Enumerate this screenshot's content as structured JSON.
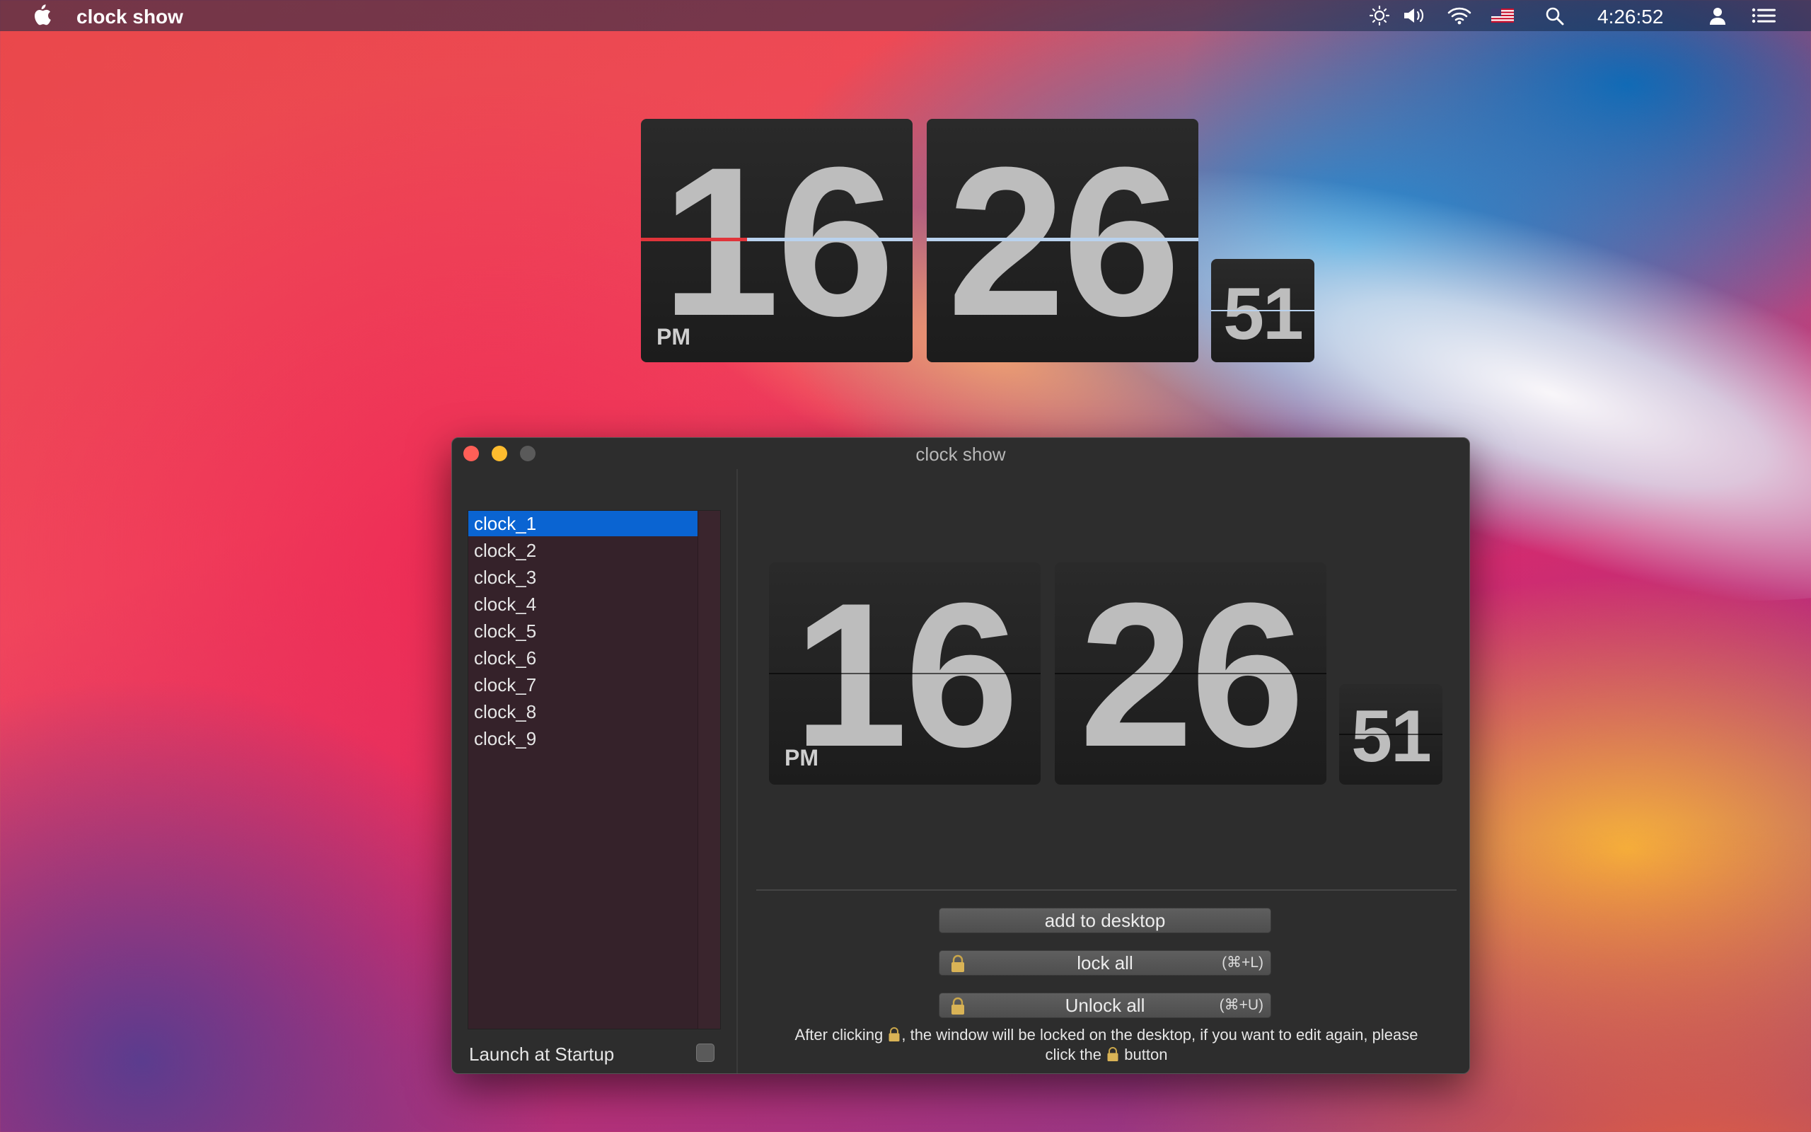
{
  "menubar": {
    "app_name": "clock show",
    "time": "4:26:52",
    "icons": [
      "apple-icon",
      "brightness-icon",
      "volume-icon",
      "wifi-icon",
      "us-flag-icon",
      "search-icon",
      "user-icon",
      "list-icon"
    ]
  },
  "desktop_clock": {
    "hours": "16",
    "minutes": "26",
    "seconds": "51",
    "ampm": "PM"
  },
  "window": {
    "title": "clock show",
    "clocks": [
      "clock_1",
      "clock_2",
      "clock_3",
      "clock_4",
      "clock_5",
      "clock_6",
      "clock_7",
      "clock_8",
      "clock_9"
    ],
    "selected_clock": "clock_1",
    "launch_at_startup_label": "Launch at Startup",
    "launch_at_startup": false,
    "preview": {
      "hours": "16",
      "minutes": "26",
      "seconds": "51",
      "ampm": "PM"
    },
    "buttons": {
      "add_to_desktop": "add to desktop",
      "lock_all": "lock all",
      "lock_all_shortcut": "(⌘+L)",
      "unlock_all": "Unlock all",
      "unlock_all_shortcut": "(⌘+U)"
    },
    "note": {
      "part1": "After clicking",
      "part2": ", the window will be locked on the desktop, if you want to edit again, please",
      "part3": "click the",
      "part4": "button"
    }
  },
  "colors": {
    "accent_selection": "#0a64d2",
    "close": "#ff5f57",
    "minimize": "#febc2e",
    "zoom": "#5a5a5a"
  }
}
